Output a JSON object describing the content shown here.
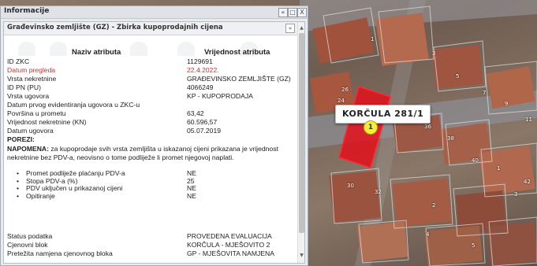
{
  "window": {
    "title": "Informacije",
    "btn_collapse": "«",
    "btn_max": "□",
    "btn_close": "X"
  },
  "panel": {
    "title": "Građevinsko zemljište (GZ) - Zbirka kupoprodajnih cijena",
    "collapse": "«"
  },
  "table": {
    "header_name": "Naziv atributa",
    "header_value": "Vrijednost atributa",
    "rows": [
      {
        "name": "ID ZKC",
        "value": "1129691"
      },
      {
        "name": "Datum pregleda",
        "value": "22.4.2022.",
        "highlight": "#c0392b"
      },
      {
        "name": "Vrsta nekretnine",
        "value": "GRAĐEVINSKO ZEMLJIŠTE (GZ)"
      },
      {
        "name": "ID PN (PU)",
        "value": "4066249"
      },
      {
        "name": "Vrsta ugovora",
        "value": "KP - KUPOPRODAJA"
      },
      {
        "name": "Datum prvog evidentiranja ugovora u ZKC-u",
        "value": ""
      },
      {
        "name": "Površina u prometu",
        "value": "63,42"
      },
      {
        "name": "Vrijednost nekretnine (KN)",
        "value": "60.596,57"
      },
      {
        "name": "Datum ugovora",
        "value": "05.07.2019"
      }
    ],
    "porezi_label": "POREZI:",
    "note_bold": "NAPOMENA:",
    "note_text": " za kupoprodaje svih vrsta zemljišta u iskazanoj cijeni prikazana je vrijednost nekretnine bez PDV-a, neovisno o tome podliježe li promet njegovoj naplati.",
    "bullets": [
      {
        "name": "Promet podliježe plaćanju PDV-a",
        "value": "NE"
      },
      {
        "name": "Stopa PDV-a (%)",
        "value": "25"
      },
      {
        "name": "PDV uključen u prikazanoj cijeni",
        "value": "NE"
      },
      {
        "name": "Opitiranje",
        "value": "NE"
      }
    ],
    "rows_bottom": [
      {
        "name": "Status podatka",
        "value": "PROVEDENA EVALUACIJA"
      },
      {
        "name": "Cjenovni blok",
        "value": "KORČULA - MJEŠOVITO 2"
      },
      {
        "name": "Pretežita namjena cjenovnog bloka",
        "value": "GP - MJEŠOVITA NAMJENA"
      }
    ]
  },
  "map": {
    "parcel_label": "KORČULA 281/1",
    "marker_number": "1",
    "house_numbers": [
      "1",
      "3",
      "5",
      "7",
      "9",
      "11",
      "26",
      "24",
      "34",
      "36",
      "38",
      "40",
      "1",
      "42",
      "3",
      "30",
      "32",
      "2",
      "4",
      "5"
    ],
    "parcel_color": "#e3101c"
  },
  "scrollbar": {
    "up": "▲",
    "down": "▼"
  }
}
